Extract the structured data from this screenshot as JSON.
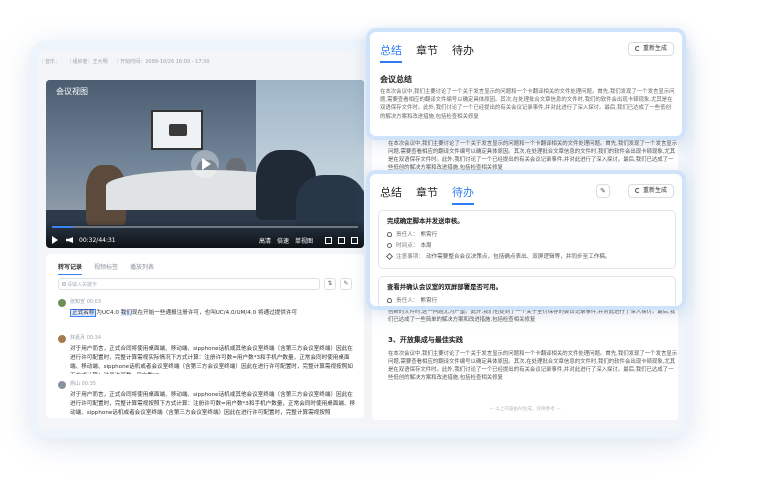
{
  "meta": {
    "items": [
      "｜音乐：",
      "｜组织者：王大明",
      "｜开始时间：2099-10/26 16:00 - 17:30"
    ]
  },
  "video": {
    "title": "会议视图",
    "time": "00:32/44:31",
    "progress": 0.07,
    "controls": [
      "高清",
      "倍速",
      "单视图"
    ]
  },
  "transcript": {
    "tabs": [
      "转写记录",
      "视频标签",
      "播放列表"
    ],
    "search_placeholder": "请输入关键字",
    "messages": [
      {
        "speaker": "张知宣",
        "time": "00:03",
        "text_pre": "",
        "highlight": "正式名称",
        "text_mid": "为UC4.0 ",
        "highlight2": "我们",
        "text_post": "现在开始一些通报注册许可，也叫UC/4.0/UM/4.0 将通过提供许可"
      },
      {
        "speaker": "林嘉月",
        "time": "00:34",
        "text": "对于用户而言，正式合同将使用桌面端、移动端、sipphone话机或其他会议室终端（含第三方会议室终端）因此在进行许可配置时，完整计算需视实际情况下方式计算：注册许可数=用户数*3和手机户数量，正常会同时使用桌面端、移动端、sipphone话机或者会议室终端（含第三方会议室终端）因此在进行许可配置时，完整计算需视按照如下方式计算：注册许可数=用户数*3"
      },
      {
        "speaker": "杨山",
        "time": "00:35",
        "text": "对于用户而言，正式合同将使用桌面端、移动端、sipphone话机或其他会议室终端（含第三方会议室终端）因此在进行许可配置时，完整计算需视按照下方式计算：注册许可数=用户数*3和手机户数量，正常会同时使用桌面端、移动端、sipphone话机或者会议室终端（含第三方会议室终端）因此在进行许可配置时，完整计算需视按照"
      }
    ]
  },
  "right_panel": {
    "body1": "在本次会议中,我们主要讨论了一个关于发言显示的问题和一个卡翻译相关的文件处理问题。首先,我们发现了一个发言显示问题,需要查看相应的翻译文件编号以确定具体原因。其次,在处理批合文章信息的文件时,我们的软件会出现卡顿现象,尤其是在双语保存文件时。此外,我们讨论了一个已经提出的有关会议记录事件,并对此进行了深入探讨。最后,我们已达成了一些低创的解决方案和改进措施,包括检查相关修复",
    "heading3": "3、开放集成与最佳实践",
    "body3": "在本次会议中,我们主要讨论了一个关于发言显示的问题和一个卡翻译相关的文件处理问题。首先,我们发现了一个发言显示问题,需要查看相应的翻译文件编号以确定具体原因。其次,在处理批合文章信息的文件时,我们的软件会出现卡顿现象,尤其是在双语保存文件时。此外,我们讨论了一个已经提出的有关会议记录事件,并对此进行了深入探讨。最后,我们已达成了一些低创的解决方案和改进措施,包括检查相关修复",
    "body2": "创新的文件时,这一问题尤为严重。此外,我们也提到了一个关于至讨保存的会议记录事件,并对此进行了深入探讨。最后,我们已达成了一些简单的解决方案和改进措施,包括检查相关修复",
    "footer": "— 以上内容由AI生成，仅供参考 —"
  },
  "card1": {
    "tabs": [
      "总结",
      "章节",
      "待办"
    ],
    "active_tab": 0,
    "regen_label": "重新生成",
    "title": "会议总结",
    "text": "在本次会议中,我们主要讨论了一个关于发言显示的问题和一个卡翻译相关的文件处理问题。首先,我们发现了一个发言显示问题,需要查看相应的翻译文件编号以确定具体原因。其次,在处理批合文章信息的文件时,我们的软件会出现卡顿现象,尤其是在双语保存文件时。此外,我们讨论了一个已经提出的有关会议记录事件,并对此进行了深入探讨。最后,我们已达成了一些低创的解决方案和改进措施,包括检查相关修复"
  },
  "card2": {
    "tabs": [
      "总结",
      "章节",
      "待办"
    ],
    "active_tab": 2,
    "regen_label": "重新生成",
    "todos": [
      {
        "title": "完成确定脚本并发送审核。",
        "owner_label": "责任人：",
        "owner": "熊霄行",
        "time_label": "时间点：",
        "time": "本周",
        "note_label": "注意事项：",
        "note": "动作需要整合会议决策点，包括确点表出、双屏逻辑等，并同步至工作稿。"
      },
      {
        "title": "查看并确认会议室的双屏部署是否可用。",
        "owner_label": "责任人：",
        "owner": "熊霄行"
      }
    ]
  }
}
